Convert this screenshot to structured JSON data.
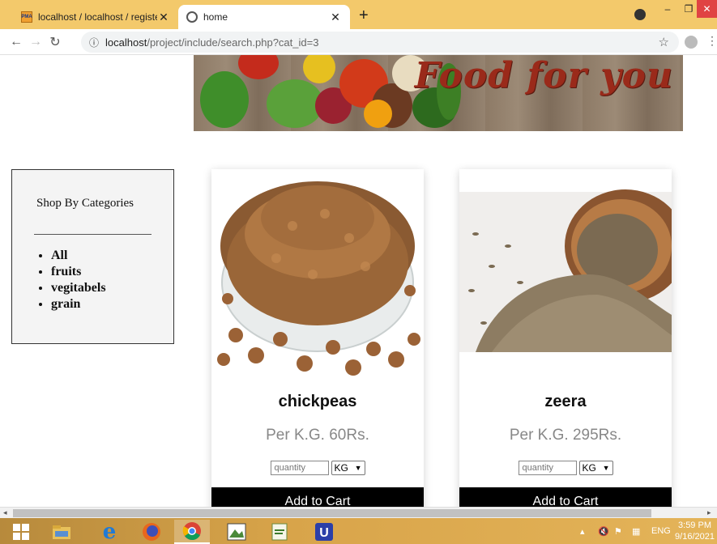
{
  "browser": {
    "tabs": [
      {
        "title": "localhost / localhost / register / s",
        "icon": "phpmyadmin-icon",
        "active": false
      },
      {
        "title": "home",
        "icon": "globe-icon",
        "active": true
      }
    ],
    "new_tab": "+",
    "url_host": "localhost",
    "url_path": "/project/include/search.php?cat_id=3"
  },
  "banner": {
    "text": "Food for you"
  },
  "sidebar": {
    "heading": "Shop By Categories",
    "categories": [
      "All",
      "fruits",
      "vegitabels",
      "grain"
    ]
  },
  "products": [
    {
      "name": "chickpeas",
      "price": "Per K.G. 60Rs.",
      "qty_placeholder": "quantity",
      "unit": "KG",
      "button": "Add to Cart"
    },
    {
      "name": "zeera",
      "price": "Per K.G. 295Rs.",
      "qty_placeholder": "quantity",
      "unit": "KG",
      "button": "Add to Cart"
    }
  ],
  "taskbar": {
    "lang": "ENG",
    "time": "3:59 PM",
    "date": "9/16/2021"
  },
  "colors": {
    "tabbar": "#f3c96b",
    "button": "#000000",
    "banner_text": "#9a2a1a"
  }
}
